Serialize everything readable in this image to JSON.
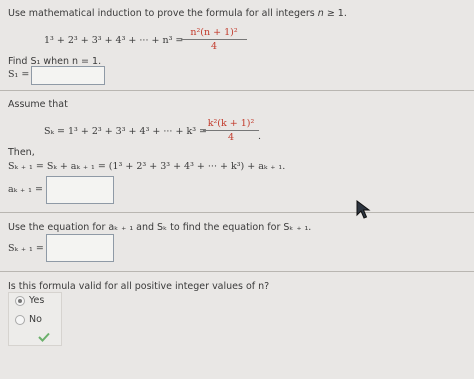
{
  "question": {
    "intro_prefix": "Use mathematical induction to prove the formula for all integers ",
    "intro_var": "n",
    "intro_suffix": " ≥ 1.",
    "formula_lhs": "1³ + 2³ + 3³ + 4³ + ··· + n³ =",
    "formula_num": "n²(n + 1)²",
    "formula_den": "4"
  },
  "part1": {
    "prompt": "Find S₁ when n = 1.",
    "label": "S₁ =",
    "value": ""
  },
  "assume": {
    "label": "Assume that",
    "sk_lhs": "Sₖ = 1³ + 2³ + 3³ + 4³ + ··· + k³ =",
    "sk_num": "k²(k + 1)²",
    "sk_den": "4",
    "sk_end": "."
  },
  "then": {
    "label": "Then,",
    "line": "Sₖ ₊ ₁ = Sₖ + aₖ ₊ ₁ = (1³ + 2³ + 3³ + 4³ + ··· + k³) + aₖ ₊ ₁.",
    "ak_label": "aₖ ₊ ₁ =",
    "ak_value": ""
  },
  "part3": {
    "prompt": "Use the equation for aₖ ₊ ₁ and Sₖ to find the equation for Sₖ ₊ ₁.",
    "label": "Sₖ ₊ ₁ =",
    "value": ""
  },
  "part4": {
    "prompt": "Is this formula valid for all positive integer values of n?",
    "options": [
      "Yes",
      "No"
    ],
    "selected": "Yes"
  }
}
